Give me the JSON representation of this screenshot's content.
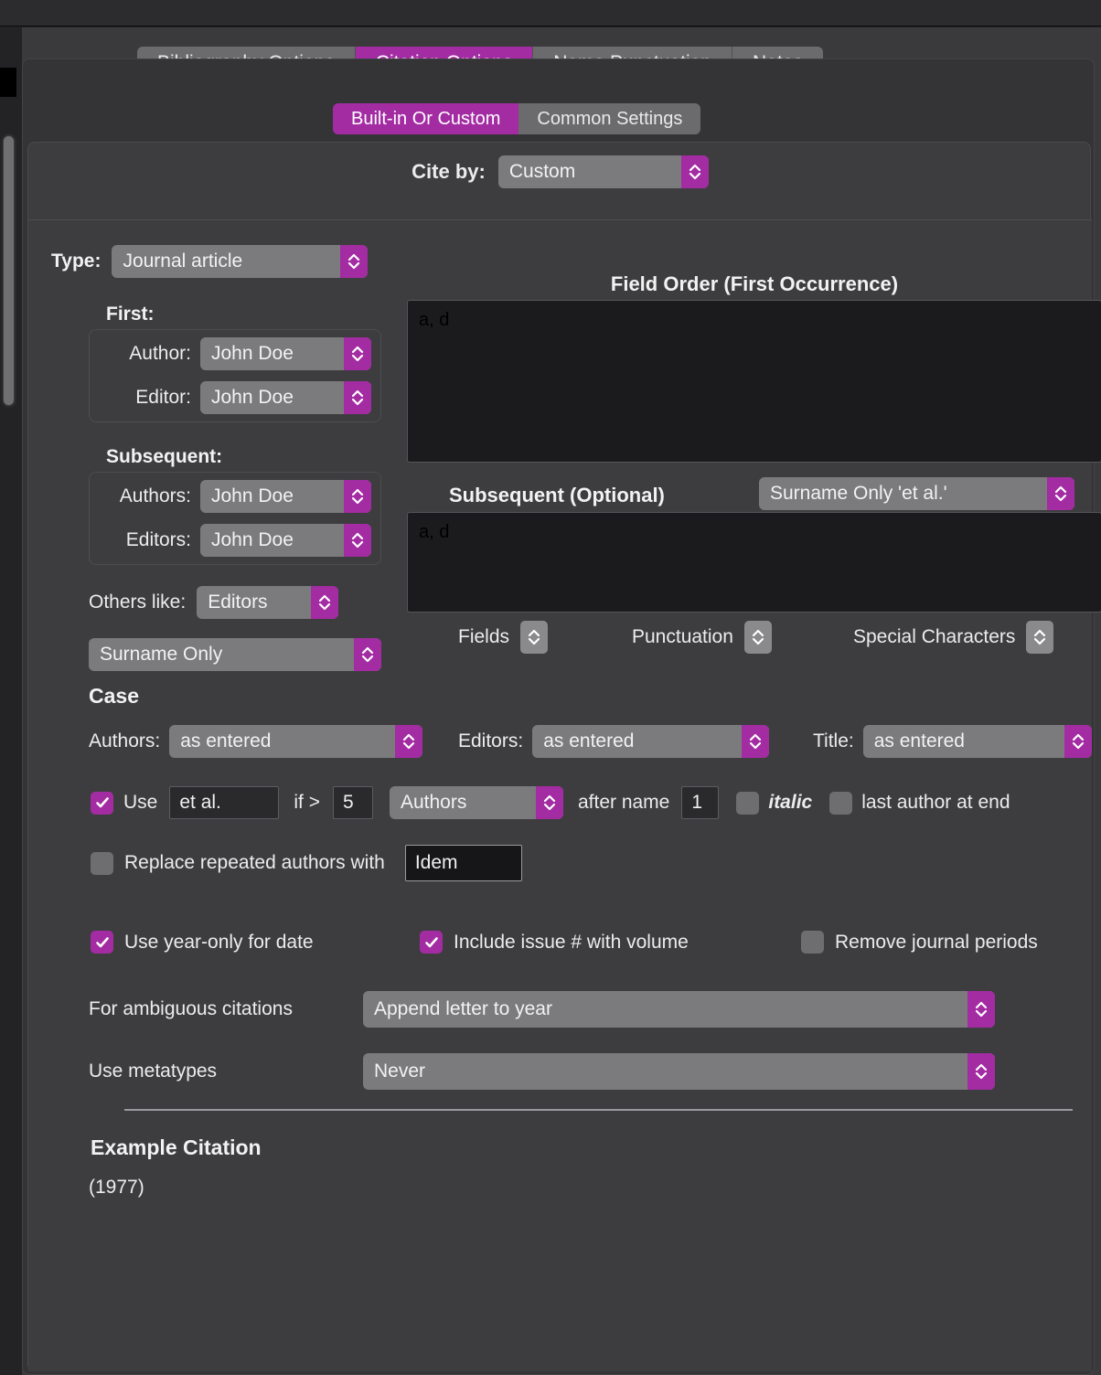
{
  "window": {
    "title": ""
  },
  "tabs": [
    {
      "label": "Bibliography Options",
      "active": false
    },
    {
      "label": "Citation Options",
      "active": true
    },
    {
      "label": "Name Punctuation",
      "active": false
    },
    {
      "label": "Notes",
      "active": false
    }
  ],
  "subtabs": [
    {
      "label": "Built-in Or Custom",
      "active": true
    },
    {
      "label": "Common Settings",
      "active": false
    }
  ],
  "cite_by": {
    "label": "Cite by:",
    "value": "Custom"
  },
  "type": {
    "label": "Type:",
    "value": "Journal article"
  },
  "first": {
    "heading": "First:",
    "author_label": "Author:",
    "author_value": "John Doe",
    "editor_label": "Editor:",
    "editor_value": "John Doe"
  },
  "subsequent": {
    "heading": "Subsequent:",
    "authors_label": "Authors:",
    "authors_value": "John Doe",
    "editors_label": "Editors:",
    "editors_value": "John Doe"
  },
  "others_like": {
    "label": "Others like:",
    "value": "Editors"
  },
  "name_format": {
    "value": "Surname Only"
  },
  "field_order": {
    "first_title": "Field Order (First Occurrence)",
    "first_value": "a, d",
    "subsequent_title": "Subsequent (Optional)",
    "subsequent_mode": "Surname Only  'et al.'",
    "subsequent_value": "a, d"
  },
  "inserters": [
    {
      "label": "Fields"
    },
    {
      "label": "Punctuation"
    },
    {
      "label": "Special Characters"
    }
  ],
  "case": {
    "heading": "Case",
    "authors_label": "Authors:",
    "authors_value": "as entered",
    "editors_label": "Editors:",
    "editors_value": "as entered",
    "title_label": "Title:",
    "title_value": "as entered"
  },
  "etal": {
    "use_checked": true,
    "use_label": "Use",
    "text_value": "et al.",
    "if_label": "if >",
    "threshold": "5",
    "scope": "Authors",
    "after_name_label": "after name",
    "after_name_value": "1",
    "italic_checked": false,
    "italic_label": "italic",
    "last_author_checked": false,
    "last_author_label": "last author at end"
  },
  "replace_repeated": {
    "checked": false,
    "label": "Replace repeated authors with",
    "value": "Idem"
  },
  "toggles": [
    {
      "label": "Use year-only for date",
      "checked": true
    },
    {
      "label": "Include issue # with volume",
      "checked": true
    },
    {
      "label": "Remove journal periods",
      "checked": false
    }
  ],
  "ambiguous": {
    "label": "For ambiguous citations",
    "value": "Append letter to year"
  },
  "metatypes": {
    "label": "Use metatypes",
    "value": "Never"
  },
  "example": {
    "heading": "Example Citation",
    "text": "(1977)"
  },
  "colors": {
    "accent": "#a32ca3",
    "panel": "#3d3d3f",
    "control": "#7b7b7d",
    "text": "#ececed"
  }
}
